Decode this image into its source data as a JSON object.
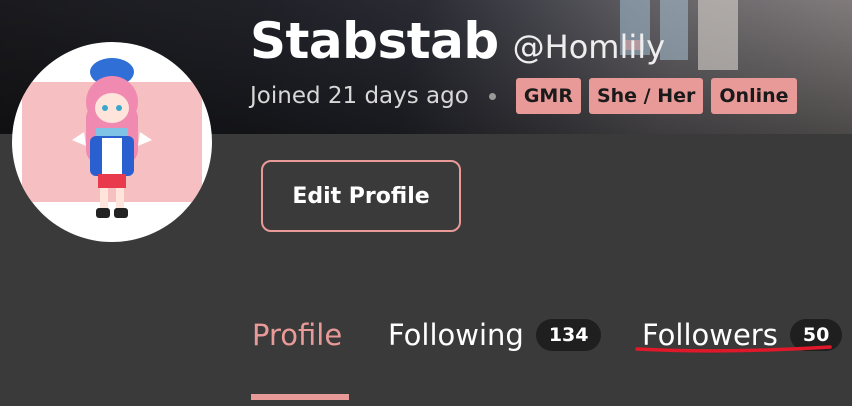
{
  "profile": {
    "display_name": "Stabstab",
    "handle": "@Homlily",
    "joined": "Joined 21 days ago",
    "badges": [
      "GMR",
      "She / Her",
      "Online"
    ]
  },
  "actions": {
    "edit_profile_label": "Edit Profile"
  },
  "tabs": [
    {
      "label": "Profile",
      "active": true
    },
    {
      "label": "Following",
      "count": "134"
    },
    {
      "label": "Followers",
      "count": "50"
    }
  ],
  "colors": {
    "accent": "#e89a98",
    "background": "#3a3a3a",
    "count_pill": "#1f1f1f",
    "annotation": "#e0182a"
  }
}
